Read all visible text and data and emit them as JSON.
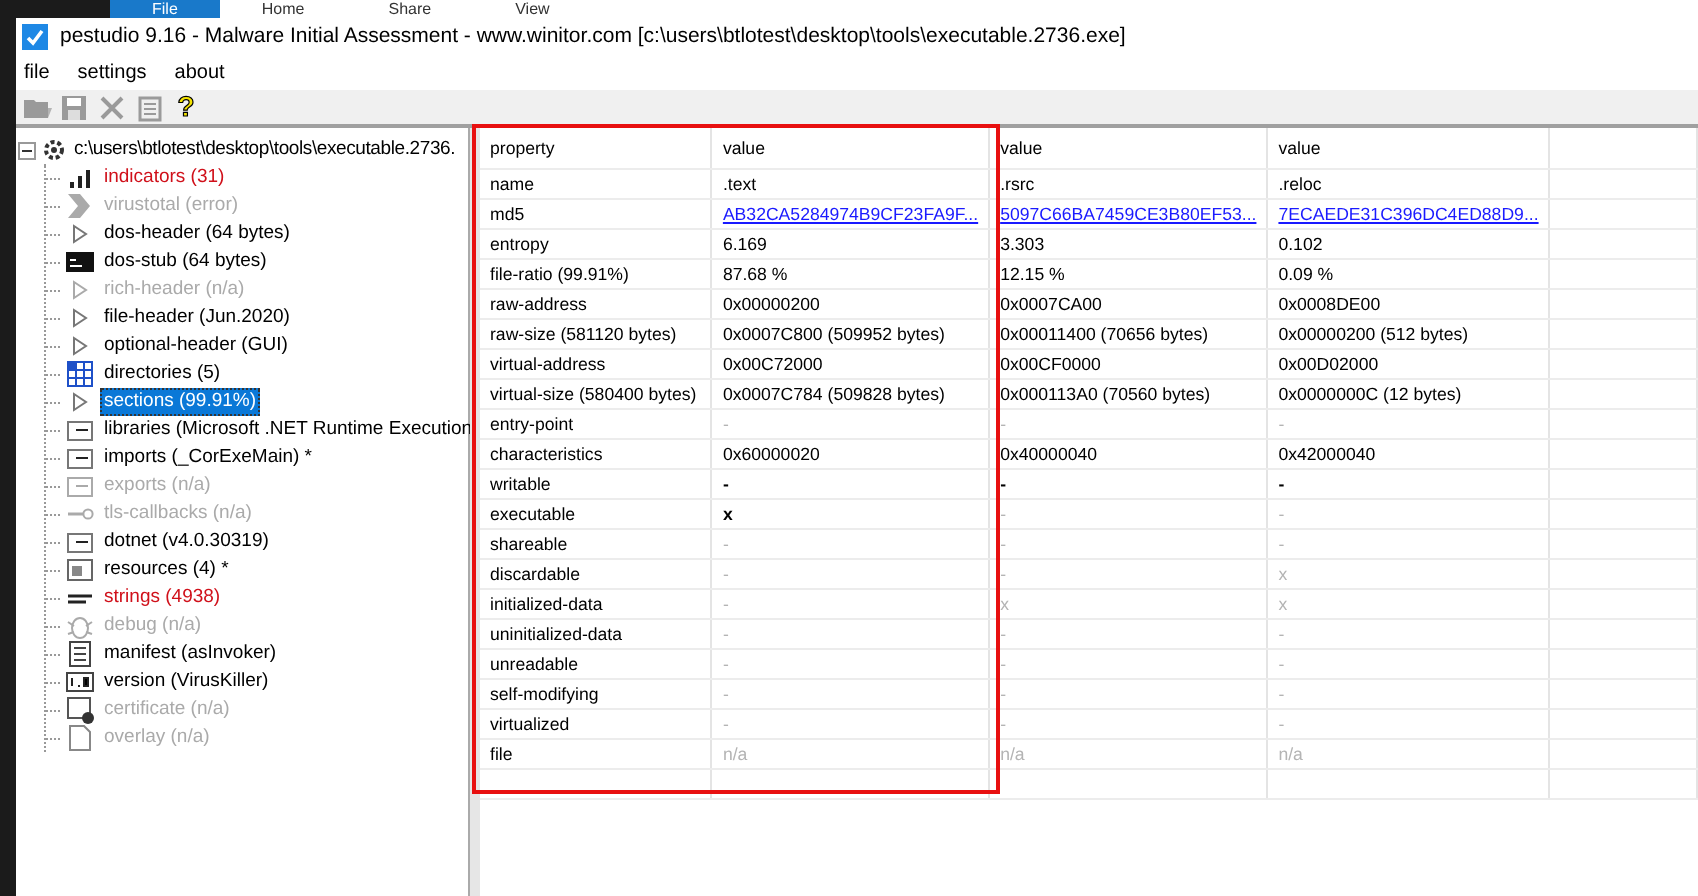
{
  "background_ribbon": {
    "tabs": [
      {
        "label": "File",
        "selected": true
      },
      {
        "label": "Home",
        "selected": false
      },
      {
        "label": "Share",
        "selected": false
      },
      {
        "label": "View",
        "selected": false
      }
    ]
  },
  "window": {
    "title": "pestudio 9.16 - Malware Initial Assessment - www.winitor.com [c:\\users\\btlotest\\desktop\\tools\\executable.2736.exe]"
  },
  "menu": [
    "file",
    "settings",
    "about"
  ],
  "toolbar": [
    {
      "kind": "open",
      "disabled": true
    },
    {
      "kind": "save",
      "disabled": true
    },
    {
      "kind": "cut",
      "disabled": true
    },
    {
      "kind": "clipboard",
      "disabled": true
    },
    {
      "kind": "help",
      "symbol": "?",
      "disabled": false
    }
  ],
  "tree": {
    "root": {
      "label": "c:\\users\\btlotest\\desktop\\tools\\executable.2736.",
      "expanded": true,
      "children": [
        {
          "label": "indicators (31)",
          "kind": "bars",
          "flagged": true,
          "disabled": false,
          "selected": false
        },
        {
          "label": "virustotal (error)",
          "kind": "chevron",
          "flagged": false,
          "disabled": true,
          "selected": false
        },
        {
          "label": "dos-header (64 bytes)",
          "kind": "triangle",
          "flagged": false,
          "disabled": false,
          "selected": false
        },
        {
          "label": "dos-stub (64 bytes)",
          "kind": "console",
          "flagged": false,
          "disabled": false,
          "selected": false
        },
        {
          "label": "rich-header (n/a)",
          "kind": "triangle",
          "flagged": false,
          "disabled": true,
          "selected": false
        },
        {
          "label": "file-header (Jun.2020)",
          "kind": "triangle",
          "flagged": false,
          "disabled": false,
          "selected": false
        },
        {
          "label": "optional-header (GUI)",
          "kind": "triangle",
          "flagged": false,
          "disabled": false,
          "selected": false
        },
        {
          "label": "directories (5)",
          "kind": "grid",
          "flagged": false,
          "disabled": false,
          "selected": false
        },
        {
          "label": "sections (99.91%)",
          "kind": "triangle",
          "flagged": false,
          "disabled": false,
          "selected": true
        },
        {
          "label": "libraries (Microsoft .NET Runtime Execution",
          "kind": "module",
          "flagged": false,
          "disabled": false,
          "selected": false
        },
        {
          "label": "imports (_CorExeMain) *",
          "kind": "module",
          "flagged": false,
          "disabled": false,
          "selected": false
        },
        {
          "label": "exports (n/a)",
          "kind": "module",
          "flagged": false,
          "disabled": true,
          "selected": false
        },
        {
          "label": "tls-callbacks (n/a)",
          "kind": "key",
          "flagged": false,
          "disabled": true,
          "selected": false
        },
        {
          "label": "dotnet (v4.0.30319)",
          "kind": "module",
          "flagged": false,
          "disabled": false,
          "selected": false
        },
        {
          "label": "resources (4) *",
          "kind": "picture",
          "flagged": false,
          "disabled": false,
          "selected": false
        },
        {
          "label": "strings (4938)",
          "kind": "abc",
          "flagged": true,
          "disabled": false,
          "selected": false
        },
        {
          "label": "debug (n/a)",
          "kind": "bug",
          "flagged": false,
          "disabled": true,
          "selected": false
        },
        {
          "label": "manifest (asInvoker)",
          "kind": "document",
          "flagged": false,
          "disabled": false,
          "selected": false
        },
        {
          "label": "version (VirusKiller)",
          "kind": "version",
          "flagged": false,
          "disabled": false,
          "selected": false
        },
        {
          "label": "certificate (n/a)",
          "kind": "certificate",
          "flagged": false,
          "disabled": true,
          "selected": false
        },
        {
          "label": "overlay (n/a)",
          "kind": "page",
          "flagged": false,
          "disabled": true,
          "selected": false
        }
      ]
    }
  },
  "table": {
    "columns": [
      "property",
      "value",
      "value",
      "value"
    ],
    "rows": [
      {
        "cells": [
          {
            "text": "name",
            "kind": "text"
          },
          {
            "text": ".text",
            "kind": "text"
          },
          {
            "text": ".rsrc",
            "kind": "text"
          },
          {
            "text": ".reloc",
            "kind": "text"
          }
        ]
      },
      {
        "cells": [
          {
            "text": "md5",
            "kind": "text"
          },
          {
            "text": "AB32CA5284974B9CF23FA9F...",
            "kind": "link"
          },
          {
            "text": "5097C66BA7459CE3B80EF53...",
            "kind": "link"
          },
          {
            "text": "7ECAEDE31C396DC4ED88D9...",
            "kind": "link"
          }
        ]
      },
      {
        "cells": [
          {
            "text": "entropy",
            "kind": "text"
          },
          {
            "text": "6.169",
            "kind": "text"
          },
          {
            "text": "3.303",
            "kind": "text"
          },
          {
            "text": "0.102",
            "kind": "text"
          }
        ]
      },
      {
        "cells": [
          {
            "text": "file-ratio (99.91%)",
            "kind": "text"
          },
          {
            "text": "87.68 %",
            "kind": "text"
          },
          {
            "text": "12.15 %",
            "kind": "text"
          },
          {
            "text": "0.09 %",
            "kind": "text"
          }
        ]
      },
      {
        "cells": [
          {
            "text": "raw-address",
            "kind": "text"
          },
          {
            "text": "0x00000200",
            "kind": "text"
          },
          {
            "text": "0x0007CA00",
            "kind": "text"
          },
          {
            "text": "0x0008DE00",
            "kind": "text"
          }
        ]
      },
      {
        "cells": [
          {
            "text": "raw-size (581120 bytes)",
            "kind": "text"
          },
          {
            "text": "0x0007C800 (509952 bytes)",
            "kind": "text"
          },
          {
            "text": "0x00011400 (70656 bytes)",
            "kind": "text"
          },
          {
            "text": "0x00000200 (512 bytes)",
            "kind": "text"
          }
        ]
      },
      {
        "cells": [
          {
            "text": "virtual-address",
            "kind": "text"
          },
          {
            "text": "0x00C72000",
            "kind": "text"
          },
          {
            "text": "0x00CF0000",
            "kind": "text"
          },
          {
            "text": "0x00D02000",
            "kind": "text"
          }
        ]
      },
      {
        "cells": [
          {
            "text": "virtual-size (580400 bytes)",
            "kind": "text"
          },
          {
            "text": "0x0007C784 (509828 bytes)",
            "kind": "text"
          },
          {
            "text": "0x000113A0 (70560 bytes)",
            "kind": "text"
          },
          {
            "text": "0x0000000C (12 bytes)",
            "kind": "text"
          }
        ]
      },
      {
        "cells": [
          {
            "text": "entry-point",
            "kind": "text"
          },
          {
            "text": "-",
            "kind": "muted"
          },
          {
            "text": "-",
            "kind": "muted"
          },
          {
            "text": "-",
            "kind": "muted"
          }
        ]
      },
      {
        "cells": [
          {
            "text": "characteristics",
            "kind": "text"
          },
          {
            "text": "0x60000020",
            "kind": "text"
          },
          {
            "text": "0x40000040",
            "kind": "text"
          },
          {
            "text": "0x42000040",
            "kind": "text"
          }
        ]
      },
      {
        "cells": [
          {
            "text": "writable",
            "kind": "text"
          },
          {
            "text": "-",
            "kind": "flag"
          },
          {
            "text": "-",
            "kind": "flag"
          },
          {
            "text": "-",
            "kind": "flag"
          }
        ]
      },
      {
        "cells": [
          {
            "text": "executable",
            "kind": "text"
          },
          {
            "text": "x",
            "kind": "flag"
          },
          {
            "text": "-",
            "kind": "muted"
          },
          {
            "text": "-",
            "kind": "muted"
          }
        ]
      },
      {
        "cells": [
          {
            "text": "shareable",
            "kind": "text"
          },
          {
            "text": "-",
            "kind": "muted"
          },
          {
            "text": "-",
            "kind": "muted"
          },
          {
            "text": "-",
            "kind": "muted"
          }
        ]
      },
      {
        "cells": [
          {
            "text": "discardable",
            "kind": "text"
          },
          {
            "text": "-",
            "kind": "muted"
          },
          {
            "text": "-",
            "kind": "muted"
          },
          {
            "text": "x",
            "kind": "muted"
          }
        ]
      },
      {
        "cells": [
          {
            "text": "initialized-data",
            "kind": "text"
          },
          {
            "text": "-",
            "kind": "muted"
          },
          {
            "text": "x",
            "kind": "muted"
          },
          {
            "text": "x",
            "kind": "muted"
          }
        ]
      },
      {
        "cells": [
          {
            "text": "uninitialized-data",
            "kind": "text"
          },
          {
            "text": "-",
            "kind": "muted"
          },
          {
            "text": "-",
            "kind": "muted"
          },
          {
            "text": "-",
            "kind": "muted"
          }
        ]
      },
      {
        "cells": [
          {
            "text": "unreadable",
            "kind": "text"
          },
          {
            "text": "-",
            "kind": "muted"
          },
          {
            "text": "-",
            "kind": "muted"
          },
          {
            "text": "-",
            "kind": "muted"
          }
        ]
      },
      {
        "cells": [
          {
            "text": "self-modifying",
            "kind": "text"
          },
          {
            "text": "-",
            "kind": "muted"
          },
          {
            "text": "-",
            "kind": "muted"
          },
          {
            "text": "-",
            "kind": "muted"
          }
        ]
      },
      {
        "cells": [
          {
            "text": "virtualized",
            "kind": "text"
          },
          {
            "text": "-",
            "kind": "muted"
          },
          {
            "text": "-",
            "kind": "muted"
          },
          {
            "text": "-",
            "kind": "muted"
          }
        ]
      },
      {
        "cells": [
          {
            "text": "file",
            "kind": "text"
          },
          {
            "text": "n/a",
            "kind": "muted"
          },
          {
            "text": "n/a",
            "kind": "muted"
          },
          {
            "text": "n/a",
            "kind": "muted"
          }
        ]
      }
    ]
  }
}
